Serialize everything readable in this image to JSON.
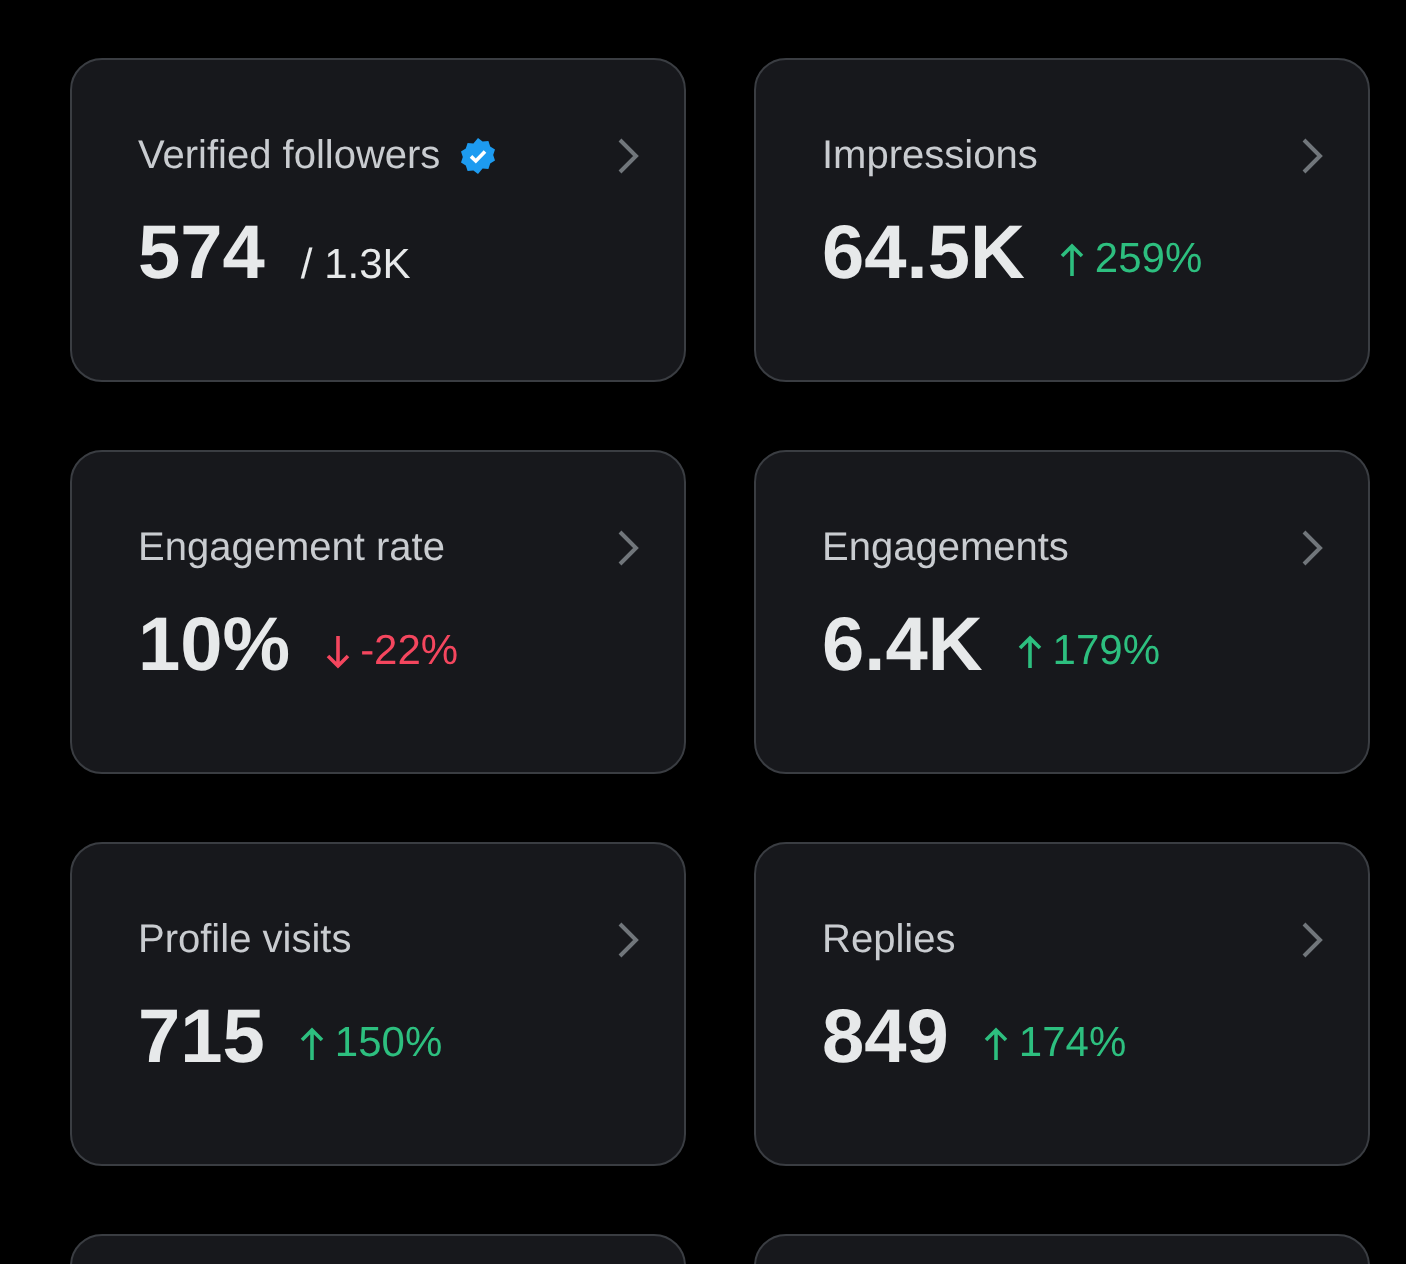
{
  "cards": [
    {
      "kind": "metric",
      "title": "Verified followers",
      "verified": true,
      "value": "574",
      "total": "/ 1.3K"
    },
    {
      "kind": "metric",
      "title": "Impressions",
      "verified": false,
      "value": "64.5K",
      "change": {
        "kind": "up",
        "text": "259%"
      }
    },
    {
      "kind": "metric",
      "title": "Engagement rate",
      "verified": false,
      "value": "10%",
      "change": {
        "kind": "down",
        "text": "-22%"
      }
    },
    {
      "kind": "metric",
      "title": "Engagements",
      "verified": false,
      "value": "6.4K",
      "change": {
        "kind": "up",
        "text": "179%"
      }
    },
    {
      "kind": "metric",
      "title": "Profile visits",
      "verified": false,
      "value": "715",
      "change": {
        "kind": "up",
        "text": "150%"
      }
    },
    {
      "kind": "metric",
      "title": "Replies",
      "verified": false,
      "value": "849",
      "change": {
        "kind": "up",
        "text": "174%"
      }
    },
    {
      "kind": "cut_off"
    },
    {
      "kind": "cut_off"
    }
  ]
}
